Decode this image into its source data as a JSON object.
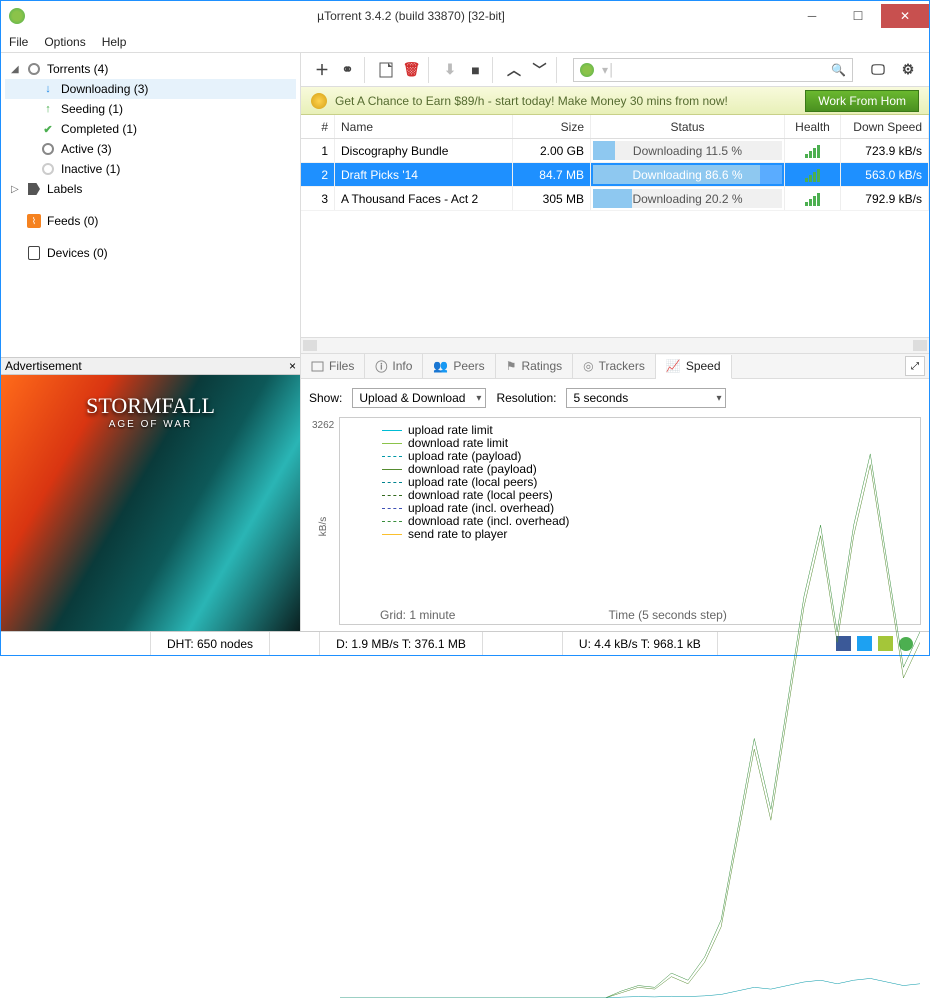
{
  "window": {
    "title": "µTorrent 3.4.2  (build 33870) [32-bit]"
  },
  "menu": [
    "File",
    "Options",
    "Help"
  ],
  "sidebar": {
    "root": {
      "label": "Torrents (4)"
    },
    "items": [
      {
        "label": "Downloading (3)",
        "icon": "down-arrow",
        "selected": true
      },
      {
        "label": "Seeding (1)",
        "icon": "up-arrow"
      },
      {
        "label": "Completed (1)",
        "icon": "check"
      },
      {
        "label": "Active (3)",
        "icon": "circle"
      },
      {
        "label": "Inactive (1)",
        "icon": "circle-faded"
      }
    ],
    "labels": "Labels",
    "feeds": "Feeds (0)",
    "devices": "Devices (0)"
  },
  "ad": {
    "header": "Advertisement",
    "title": "STORMFALL",
    "subtitle": "AGE OF WAR"
  },
  "promo": {
    "text": "Get A Chance to Earn $89/h - start today! Make Money 30 mins from now!",
    "button": "Work From Hom"
  },
  "table": {
    "headers": {
      "num": "#",
      "name": "Name",
      "size": "Size",
      "status": "Status",
      "health": "Health",
      "speed": "Down Speed"
    },
    "rows": [
      {
        "num": "1",
        "name": "Discography Bundle",
        "size": "2.00 GB",
        "status": "Downloading 11.5 %",
        "pct": 11.5,
        "speed": "723.9 kB/s",
        "selected": false
      },
      {
        "num": "2",
        "name": "Draft Picks '14",
        "size": "84.7 MB",
        "status": "Downloading 86.6 %",
        "pct": 86.6,
        "speed": "563.0 kB/s",
        "selected": true
      },
      {
        "num": "3",
        "name": "A Thousand Faces - Act 2",
        "size": "305 MB",
        "status": "Downloading 20.2 %",
        "pct": 20.2,
        "speed": "792.9 kB/s",
        "selected": false
      }
    ]
  },
  "tabs": [
    "Files",
    "Info",
    "Peers",
    "Ratings",
    "Trackers",
    "Speed"
  ],
  "speed_panel": {
    "show_label": "Show:",
    "show_value": "Upload & Download",
    "res_label": "Resolution:",
    "res_value": "5 seconds",
    "y_max": "3262",
    "y_unit": "kB/s",
    "grid_label": "Grid: 1 minute",
    "time_label": "Time (5 seconds step)",
    "legend": [
      {
        "label": "upload rate limit",
        "color": "#00bcd4",
        "dash": "none"
      },
      {
        "label": "download rate limit",
        "color": "#8bc34a",
        "dash": "none"
      },
      {
        "label": "upload rate (payload)",
        "color": "#0097a7",
        "dash": "4 2"
      },
      {
        "label": "download rate (payload)",
        "color": "#558b2f",
        "dash": "none"
      },
      {
        "label": "upload rate (local peers)",
        "color": "#00838f",
        "dash": "4 2"
      },
      {
        "label": "download rate (local peers)",
        "color": "#33691e",
        "dash": "4 2"
      },
      {
        "label": "upload rate (incl. overhead)",
        "color": "#3f51b5",
        "dash": "2 2"
      },
      {
        "label": "download rate (incl. overhead)",
        "color": "#388e3c",
        "dash": "2 2"
      },
      {
        "label": "send rate to player",
        "color": "#fbc02d",
        "dash": "none"
      }
    ]
  },
  "statusbar": {
    "dht": "DHT: 650 nodes",
    "down": "D: 1.9 MB/s T: 376.1 MB",
    "up": "U: 4.4 kB/s T: 968.1 kB"
  },
  "chart_data": {
    "type": "line",
    "title": "Speed",
    "xlabel": "Time (5 seconds step)",
    "ylabel": "kB/s",
    "ylim": [
      0,
      3262
    ],
    "x": [
      0,
      1,
      2,
      3,
      4,
      5,
      6,
      7,
      8,
      9,
      10,
      11,
      12,
      13,
      14,
      15,
      16,
      17,
      18,
      19,
      20,
      21,
      22,
      23,
      24,
      25,
      26,
      27,
      28,
      29,
      30,
      31,
      32,
      33,
      34,
      35
    ],
    "series": [
      {
        "name": "download rate (payload)",
        "color": "#558b2f",
        "values": [
          0,
          0,
          0,
          0,
          0,
          0,
          0,
          0,
          0,
          0,
          0,
          0,
          0,
          0,
          0,
          0,
          0,
          30,
          60,
          50,
          120,
          80,
          200,
          400,
          900,
          1400,
          1000,
          1600,
          2200,
          2600,
          2000,
          2600,
          3000,
          2400,
          1800,
          2000
        ]
      },
      {
        "name": "download rate (incl. overhead)",
        "color": "#388e3c",
        "values": [
          0,
          0,
          0,
          0,
          0,
          0,
          0,
          0,
          0,
          0,
          0,
          0,
          0,
          0,
          0,
          0,
          0,
          40,
          70,
          60,
          140,
          100,
          230,
          440,
          950,
          1460,
          1060,
          1660,
          2260,
          2660,
          2060,
          2660,
          3060,
          2460,
          1860,
          2060
        ]
      },
      {
        "name": "upload rate (payload)",
        "color": "#0097a7",
        "values": [
          0,
          0,
          0,
          0,
          0,
          0,
          0,
          0,
          0,
          0,
          0,
          0,
          0,
          0,
          0,
          0,
          0,
          5,
          8,
          6,
          10,
          8,
          12,
          20,
          40,
          60,
          50,
          70,
          90,
          100,
          80,
          100,
          110,
          90,
          70,
          80
        ]
      }
    ]
  }
}
